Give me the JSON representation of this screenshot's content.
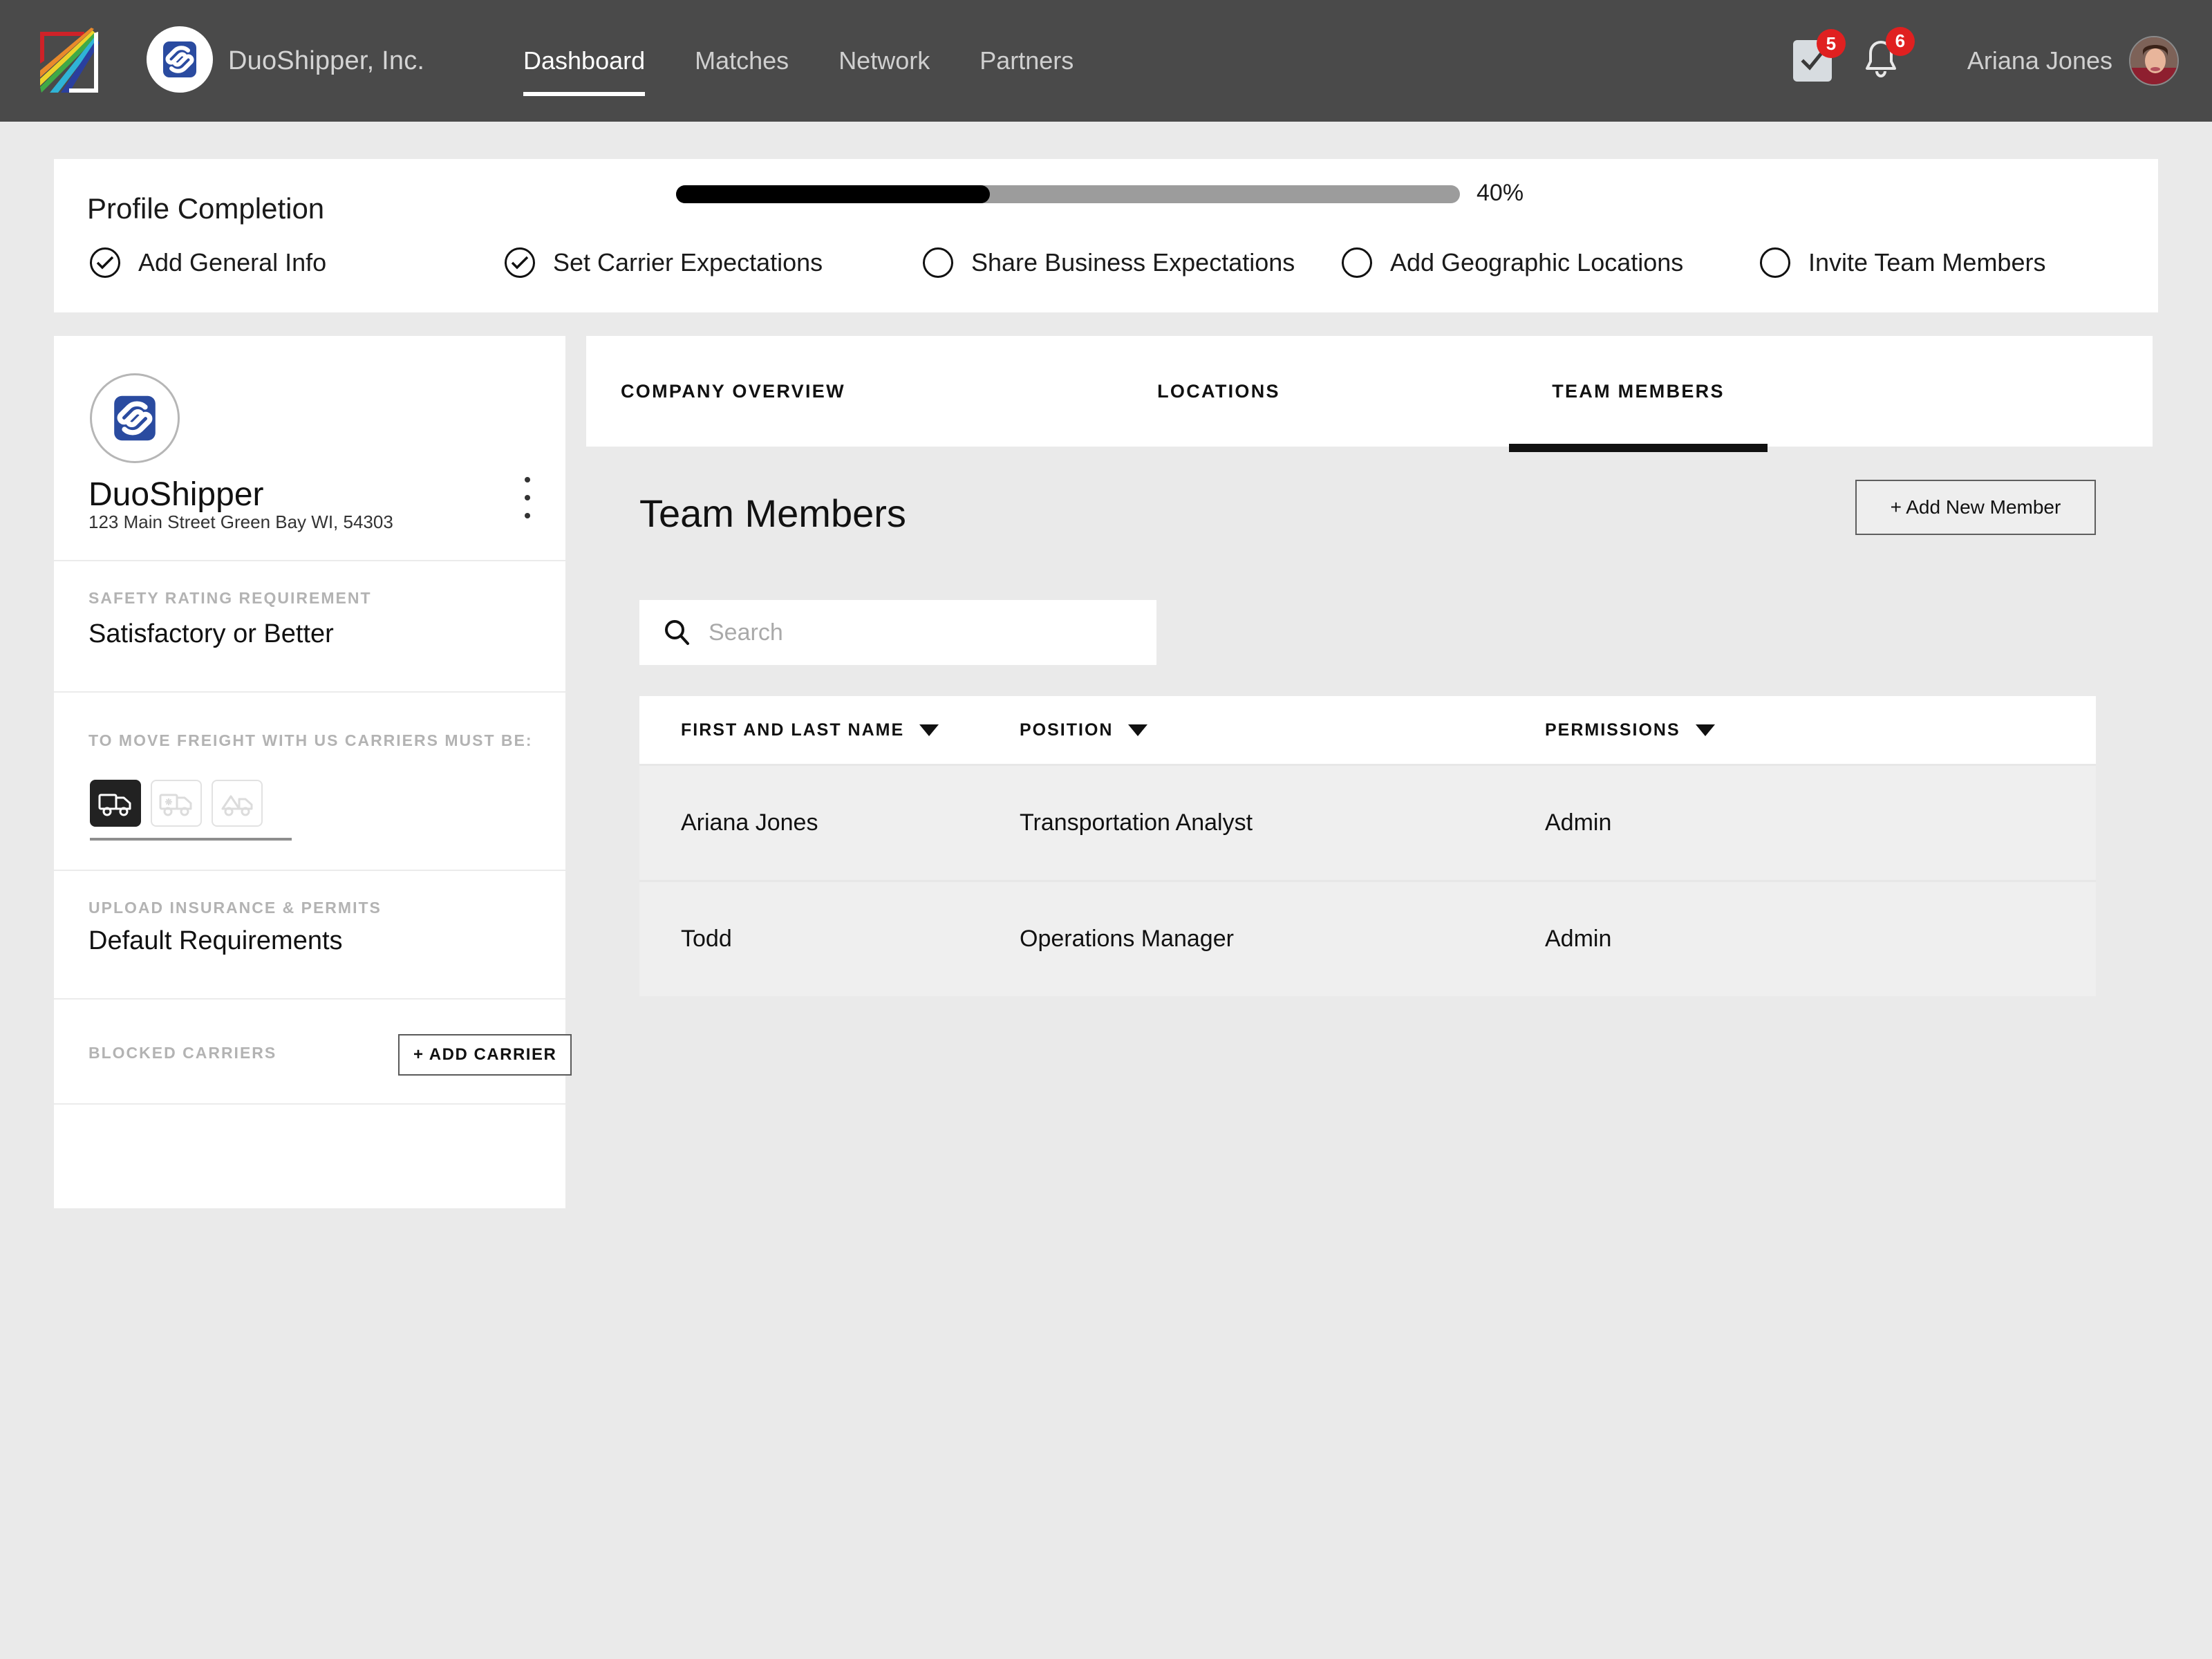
{
  "topnav": {
    "brand_logo_icon": "rainbow-prism-logo",
    "company_mark_icon": "duoshipper-mark-icon",
    "company_name": "DuoShipper, Inc.",
    "links": [
      {
        "label": "Dashboard",
        "active": true
      },
      {
        "label": "Matches",
        "active": false
      },
      {
        "label": "Network",
        "active": false
      },
      {
        "label": "Partners",
        "active": false
      }
    ],
    "tasks": {
      "icon": "checkbox-task-icon",
      "badge": "5"
    },
    "notifications": {
      "icon": "bell-icon",
      "badge": "6"
    },
    "user": {
      "name": "Ariana Jones",
      "avatar_icon": "user-avatar"
    }
  },
  "profile_completion": {
    "title": "Profile Completion",
    "percent_label": "40%",
    "percent_value": 40,
    "steps": [
      {
        "label": "Add General Info",
        "done": true
      },
      {
        "label": "Set Carrier Expectations",
        "done": true
      },
      {
        "label": "Share Business Expectations",
        "done": false
      },
      {
        "label": "Add Geographic Locations",
        "done": false
      },
      {
        "label": "Invite Team Members",
        "done": false
      }
    ]
  },
  "company_card": {
    "logo_icon": "duoshipper-mark-icon",
    "name": "DuoShipper",
    "address": "123 Main Street Green Bay WI, 54303",
    "menu_icon": "kebab-menu-icon",
    "safety": {
      "label": "SAFETY RATING REQUIREMENT",
      "value": "Satisfactory or Better"
    },
    "equipment": {
      "label": "TO MOVE FREIGHT WITH US CARRIERS MUST BE:",
      "options": [
        {
          "icon": "dry-van-truck-icon",
          "selected": true
        },
        {
          "icon": "refrigerated-truck-icon",
          "selected": false
        },
        {
          "icon": "flatbed-truck-icon",
          "selected": false
        }
      ]
    },
    "insurance": {
      "label": "UPLOAD INSURANCE & PERMITS",
      "value": "Default Requirements"
    },
    "blocked": {
      "label": "BLOCKED CARRIERS",
      "add_button": "+ ADD CARRIER"
    }
  },
  "main_panel": {
    "tabs": [
      {
        "label": "COMPANY OVERVIEW",
        "active": false
      },
      {
        "label": "LOCATIONS",
        "active": false
      },
      {
        "label": "TEAM MEMBERS",
        "active": true
      }
    ],
    "title": "Team Members",
    "add_member_button": "+ Add New Member",
    "search": {
      "icon": "search-icon",
      "value": "",
      "placeholder": "Search"
    },
    "table": {
      "columns": [
        {
          "label": "FIRST AND LAST NAME",
          "sort_icon": "caret-down-icon"
        },
        {
          "label": "POSITION",
          "sort_icon": "caret-down-icon"
        },
        {
          "label": "PERMISSIONS",
          "sort_icon": "caret-down-icon"
        }
      ],
      "rows": [
        {
          "name": "Ariana Jones",
          "position": "Transportation Analyst",
          "permissions": "Admin"
        },
        {
          "name": "Todd",
          "position": "Operations Manager",
          "permissions": "Admin"
        }
      ]
    }
  },
  "colors": {
    "topnav_bg": "#4a4a4a",
    "page_bg": "#eaeaea",
    "card_bg": "#ffffff",
    "row_bg": "#efefef",
    "accent": "#000000",
    "badge_red": "#e02020",
    "brand_blue": "#2a4ba0"
  }
}
